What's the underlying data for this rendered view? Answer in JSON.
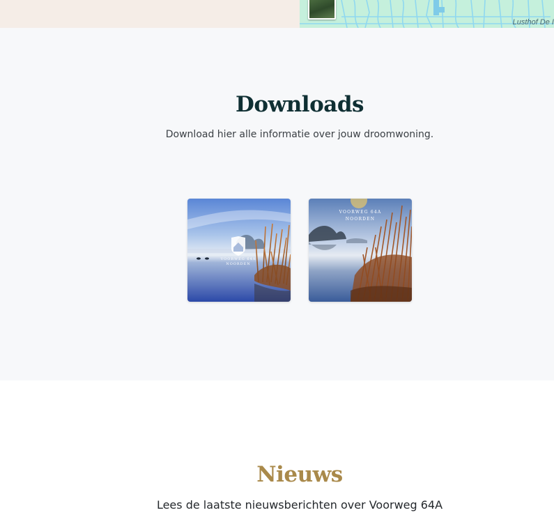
{
  "map": {
    "place_label": "Lusthof De I"
  },
  "downloads": {
    "title": "Downloads",
    "subtitle": "Download hier alle informatie over jouw droomwoning.",
    "items": [
      {
        "image": "lake-logo-cover-image",
        "overlay_text": "VOORWEG 64A NOORDEN"
      },
      {
        "image": "lake-reeds-cover-image",
        "overlay_text": "VOORWEG 64A NOORDEN"
      }
    ]
  },
  "news": {
    "title": "Nieuws",
    "subtitle": "Lees de laatste nieuwsberichten over Voorweg 64A"
  },
  "colors": {
    "downloads_title": "#0f2f33",
    "news_title": "#a9894a",
    "downloads_bg": "#f7f8fa",
    "map_bg": "#c5f0dc"
  }
}
